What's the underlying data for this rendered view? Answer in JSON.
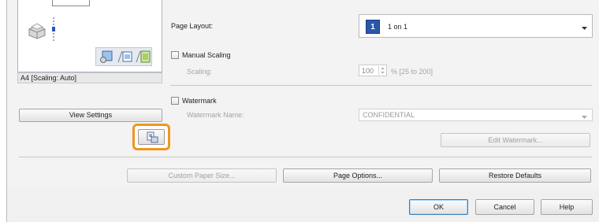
{
  "preview": {
    "caption": "A4 [Scaling: Auto]"
  },
  "left": {
    "view_settings_label": "View Settings"
  },
  "layout": {
    "page_layout_label": "Page Layout:",
    "page_layout_badge": "1",
    "page_layout_value": "1 on 1",
    "manual_scaling_label": "Manual Scaling",
    "scaling_label": "Scaling:",
    "scaling_value": "100",
    "scaling_range": "% [25 to 200]"
  },
  "watermark": {
    "checkbox_label": "Watermark",
    "name_label": "Watermark Name:",
    "name_value": "CONFIDENTIAL",
    "edit_label": "Edit Watermark..."
  },
  "actions": {
    "custom_paper_size": "Custom Paper Size...",
    "page_options": "Page Options...",
    "restore_defaults": "Restore Defaults"
  },
  "dialog": {
    "ok": "OK",
    "cancel": "Cancel",
    "help": "Help"
  },
  "colors": {
    "highlight": "#f0961e",
    "badge_bg": "#2a57a8"
  },
  "icons": [
    "printer-icon",
    "layout-view-icon",
    "copy-view-icon",
    "page-view-icon",
    "settings-preview-icon",
    "chevron-down-icon",
    "spin-arrows-icon"
  ]
}
